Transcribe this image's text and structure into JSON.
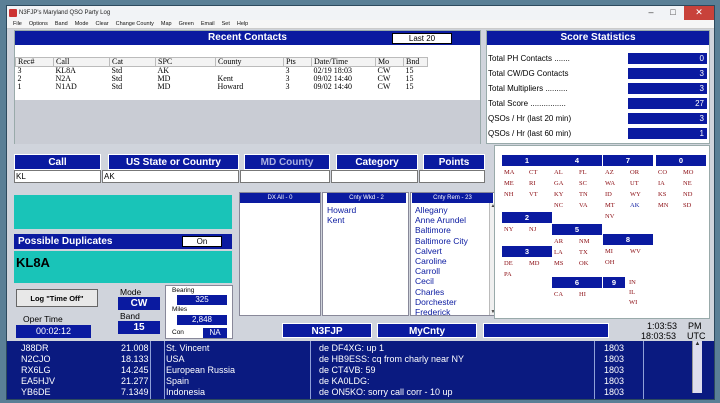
{
  "window": {
    "title": "N3FJP's Maryland QSO Party Log"
  },
  "menu": [
    "File",
    "Options",
    "Band",
    "Mode",
    "Clear",
    "Change County",
    "Map",
    "Green",
    "Email",
    "Set",
    "Help"
  ],
  "recent": {
    "title": "Recent Contacts",
    "last_button": "Last 20",
    "columns": [
      "Rec#",
      "Call",
      "Cat",
      "SPC",
      "County",
      "Pts",
      "Date/Time",
      "Mo",
      "Bnd"
    ],
    "rows": [
      [
        "3",
        "KL8A",
        "Std",
        "AK",
        "",
        "3",
        "02/19 18:03",
        "CW",
        "15"
      ],
      [
        "2",
        "N2A",
        "Std",
        "MD",
        "Kent",
        "3",
        "09/02 14:40",
        "CW",
        "15"
      ],
      [
        "1",
        "N1AD",
        "Std",
        "MD",
        "Howard",
        "3",
        "09/02 14:40",
        "CW",
        "15"
      ]
    ]
  },
  "score": {
    "title": "Score Statistics",
    "rows": [
      {
        "label": "Total PH Contacts .......",
        "value": "0"
      },
      {
        "label": "Total CW/DG Contacts",
        "value": "3"
      },
      {
        "label": "Total Multipliers ..........",
        "value": "3"
      },
      {
        "label": "Total Score ................",
        "value": "27"
      },
      {
        "label": "QSOs / Hr (last 20 min)",
        "value": "3"
      },
      {
        "label": "QSOs / Hr (last 60 min)",
        "value": "1"
      }
    ]
  },
  "entry": {
    "call_label": "Call",
    "call_value": "KL",
    "state_label": "US State or Country",
    "state_value": "AK",
    "county_label": "MD County",
    "county_value": "",
    "category_label": "Category",
    "category_value": "",
    "points_label": "Points",
    "points_value": ""
  },
  "dup": {
    "label": "Possible Duplicates",
    "toggle": "On",
    "call": "KL8A"
  },
  "controls": {
    "log_button": "Log \"Time Off\"",
    "mode_label": "Mode",
    "mode_value": "CW",
    "band_label": "Band",
    "band_value": "15",
    "oper_label": "Oper Time",
    "oper_value": "00:02:12",
    "bearing_label": "Bearing",
    "bearing_value": "325",
    "miles_label": "Miles",
    "miles_value": "2,848",
    "con_label": "Con",
    "con_value": "NA"
  },
  "lists": {
    "dx": {
      "title": "DX All - 0",
      "items": []
    },
    "cnty_wkd": {
      "title": "Cnty Wkd - 2",
      "items": [
        "Howard",
        "Kent"
      ]
    },
    "cnty_rem": {
      "title": "Cnty Rem - 23",
      "items": [
        "Allegany",
        "Anne Arundel",
        "Baltimore",
        "Baltimore City",
        "Calvert",
        "Caroline",
        "Carroll",
        "Cecil",
        "Charles",
        "Dorchester",
        "Frederick"
      ]
    }
  },
  "zones": [
    {
      "n": "1",
      "items": [
        "MA",
        "CT",
        "ME",
        "RI",
        "NH",
        "VT"
      ],
      "blue": []
    },
    {
      "n": "4",
      "items": [
        "AL",
        "FL",
        "GA",
        "SC",
        "KY",
        "TN",
        "NC",
        "VA"
      ],
      "blue": []
    },
    {
      "n": "7",
      "items": [
        "AZ",
        "OR",
        "WA",
        "UT",
        "ID",
        "WY",
        "MT",
        "AK",
        "NV"
      ],
      "blue": [
        "AK"
      ]
    },
    {
      "n": "0",
      "items": [
        "CO",
        "MO",
        "IA",
        "NE",
        "KS",
        "ND",
        "MN",
        "SD"
      ],
      "blue": []
    },
    {
      "n": "2",
      "items": [
        "NY",
        "NJ"
      ],
      "blue": []
    },
    {
      "n": "5",
      "items": [
        "AR",
        "NM",
        "LA",
        "TX",
        "MS",
        "OK"
      ],
      "blue": []
    },
    {
      "n": "3",
      "items": [
        "DE",
        "MD",
        "PA"
      ],
      "blue": []
    },
    {
      "n": "8",
      "items": [
        "MI",
        "WV",
        "OH"
      ],
      "blue": []
    },
    {
      "n": "6",
      "items": [
        "CA",
        "HI"
      ],
      "blue": []
    },
    {
      "n": "9",
      "items": [
        "IN",
        "IL",
        "WI"
      ],
      "blue": []
    }
  ],
  "bottom": {
    "station": "N3FJP",
    "mycnty": "MyCnty",
    "local_time": "1:03:53",
    "ampm": "PM",
    "utc_time": "18:03:53",
    "utc": "UTC"
  },
  "cluster": [
    {
      "call": "J88DR",
      "freq": "21.008",
      "country": "St. Vincent",
      "spot": "de DF4XG:  up 1",
      "time": "1803"
    },
    {
      "call": "N2CJO",
      "freq": "18.133",
      "country": "USA",
      "spot": "de HB9ESS:  cq from charly near NY",
      "time": "1803"
    },
    {
      "call": "RX6LG",
      "freq": "14.245",
      "country": "European Russia",
      "spot": "de CT4VB:  59",
      "time": "1803"
    },
    {
      "call": "EA5HJV",
      "freq": "21.277",
      "country": "Spain",
      "spot": "de KA0LDG:",
      "time": "1803"
    },
    {
      "call": "YB6DE",
      "freq": "7.1349",
      "country": "Indonesia",
      "spot": "de ON5KO:  sorry call corr - 10 up",
      "time": "1803"
    }
  ]
}
